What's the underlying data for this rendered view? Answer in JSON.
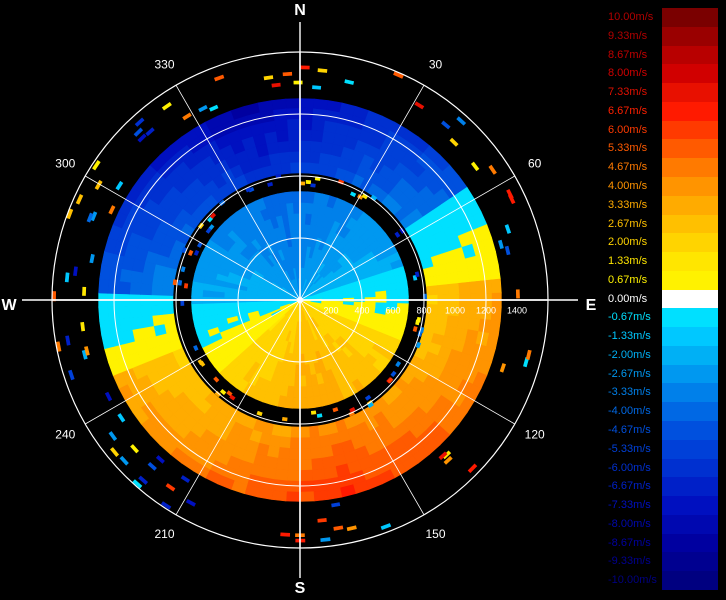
{
  "chart_data": {
    "type": "heatmap",
    "subtype": "polar radial-velocity PPI",
    "compass_labels": [
      "N",
      "E",
      "S",
      "W"
    ],
    "azimuth_labels": [
      "30",
      "60",
      "120",
      "150",
      "210",
      "240",
      "300",
      "330"
    ],
    "range_tick_labels": [
      "200",
      "400",
      "600",
      "800",
      "1000",
      "1200",
      "1400"
    ],
    "range_max": 1600,
    "colorbar": {
      "labels": [
        "10.00m/s",
        "9.33m/s",
        "8.67m/s",
        "8.00m/s",
        "7.33m/s",
        "6.67m/s",
        "6.00m/s",
        "5.33m/s",
        "4.67m/s",
        "4.00m/s",
        "3.33m/s",
        "2.67m/s",
        "2.00m/s",
        "1.33m/s",
        "0.67m/s",
        "0.00m/s",
        "-0.67m/s",
        "-1.33m/s",
        "-2.00m/s",
        "-2.67m/s",
        "-3.33m/s",
        "-4.00m/s",
        "-4.67m/s",
        "-5.33m/s",
        "-6.00m/s",
        "-6.67m/s",
        "-7.33m/s",
        "-8.00m/s",
        "-8.67m/s",
        "-9.33m/s",
        "-10.00m/s"
      ],
      "colors": [
        "#7a0000",
        "#9a0000",
        "#b80000",
        "#d10000",
        "#e81000",
        "#ff1a00",
        "#ff3a00",
        "#ff5a00",
        "#ff7a00",
        "#ff9400",
        "#ffab00",
        "#ffc000",
        "#ffd400",
        "#ffe600",
        "#fff200",
        "#ffffff",
        "#00e0ff",
        "#00c8ff",
        "#00b0f5",
        "#0098f0",
        "#0080ea",
        "#0068e4",
        "#0050de",
        "#0040d8",
        "#0030d0",
        "#0020c8",
        "#0010c0",
        "#0008b0",
        "#0000a0",
        "#000090",
        "#000080"
      ],
      "label_colors": [
        "#b00000",
        "#b00000",
        "#c00000",
        "#d00000",
        "#e01000",
        "#ff2000",
        "#ff3a00",
        "#ff5a00",
        "#ff7a00",
        "#ff9400",
        "#ffab00",
        "#ffc000",
        "#ffd400",
        "#ffe600",
        "#fff200",
        "#ffffff",
        "#00e0ff",
        "#00c8ff",
        "#00b0f5",
        "#0098f0",
        "#0080ea",
        "#0068e4",
        "#0050de",
        "#0040d8",
        "#0030d0",
        "#0020c8",
        "#0010c0",
        "#0008b0",
        "#0000a0",
        "#000090",
        "#000080"
      ]
    },
    "rings": [
      {
        "r_min": 0,
        "r_max": 700,
        "positive_center_az": 170,
        "half_width_deg": 78,
        "blend_deg": 20,
        "vmax": 3.0,
        "vmin": -3.5
      },
      {
        "r_min": 820,
        "r_max": 1300,
        "positive_center_az": 165,
        "half_width_deg": 95,
        "blend_deg": 12,
        "vmax": 5.5,
        "vmin": -7.5
      }
    ]
  }
}
